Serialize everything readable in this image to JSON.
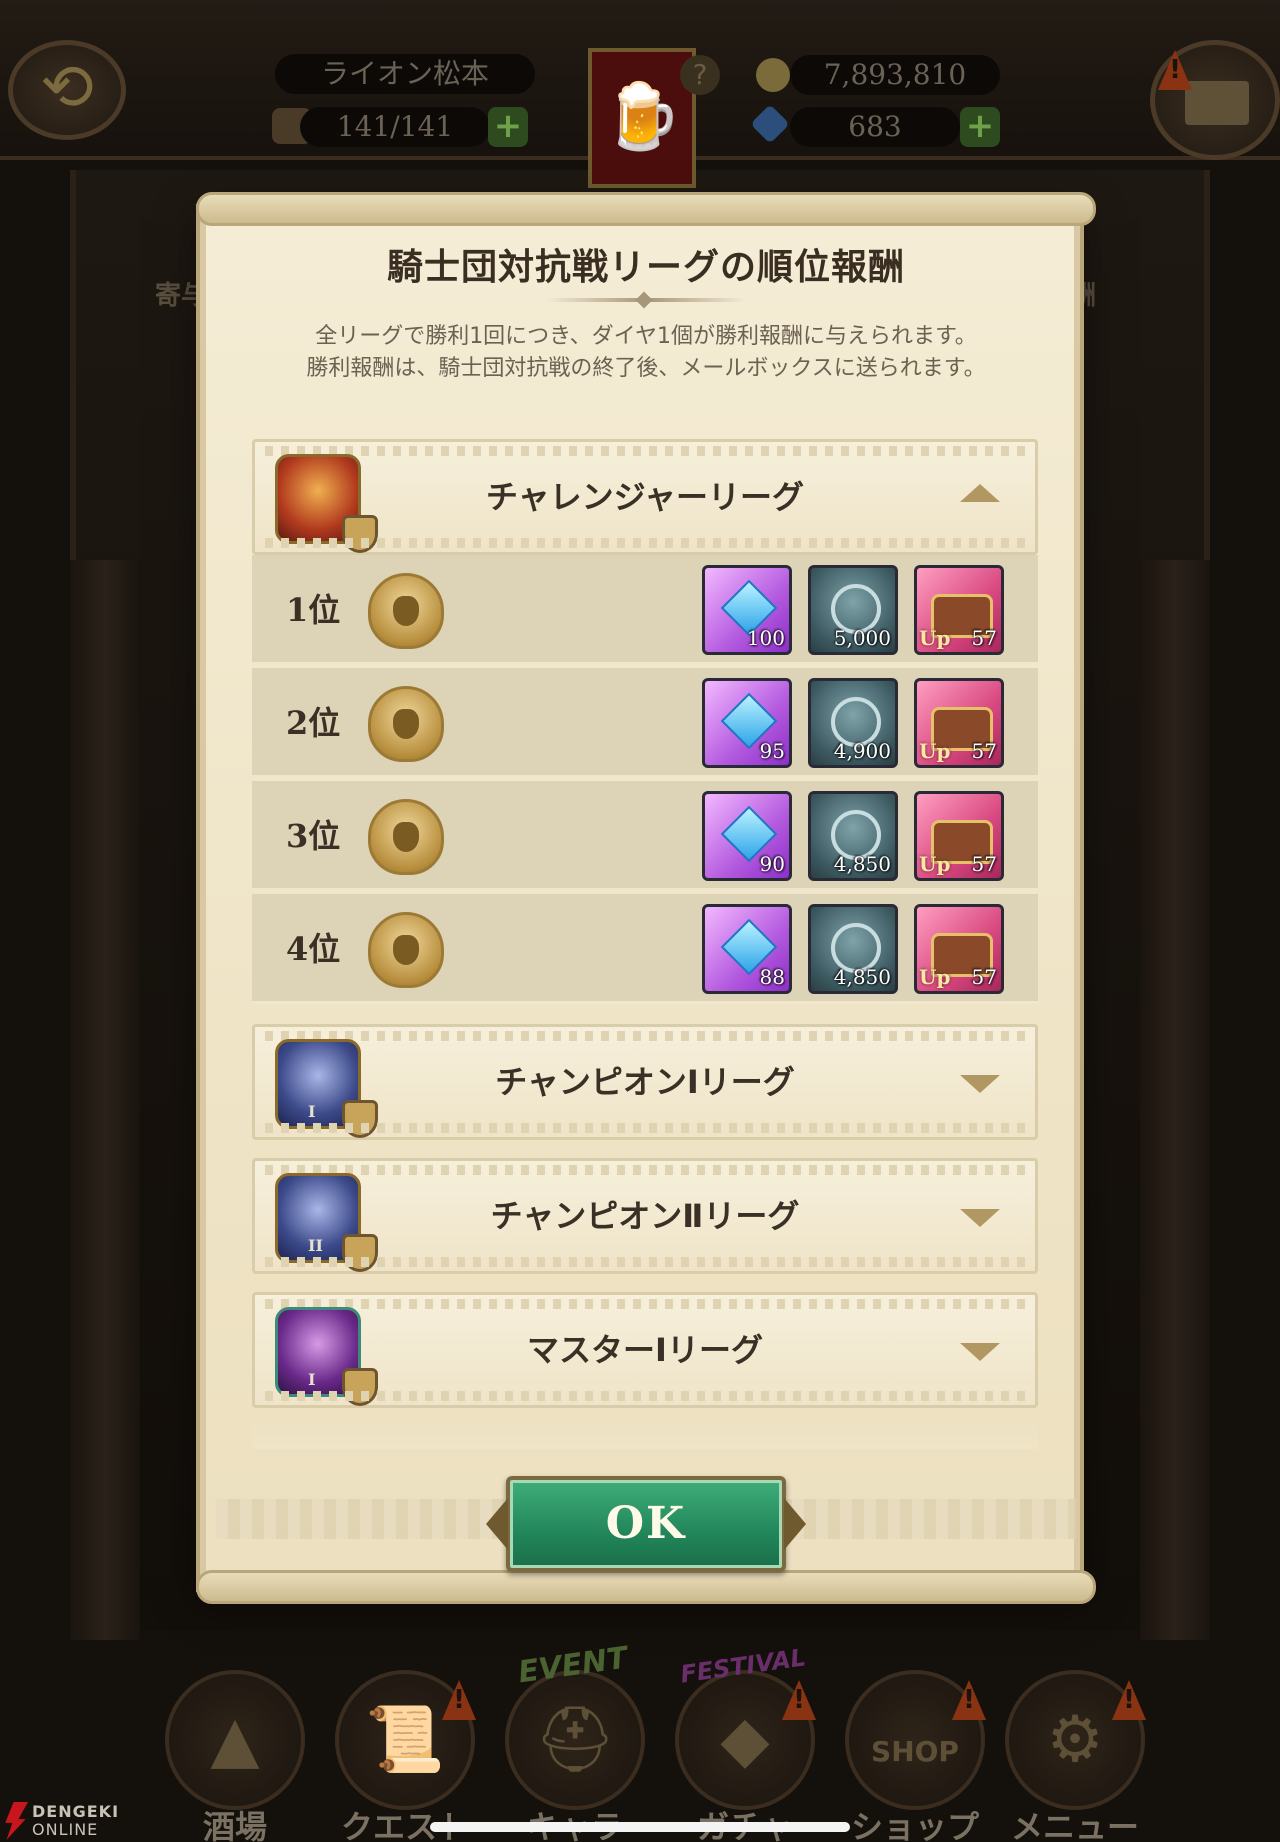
{
  "header": {
    "player_name": "ライオン松本",
    "stamina": "141/141",
    "gold": "7,893,810",
    "gems": "683"
  },
  "background_labels": {
    "left_partial": "寄与",
    "right_partial": "酬"
  },
  "dialog": {
    "title": "騎士団対抗戦リーグの順位報酬",
    "description_line1": "全リーグで勝利1回につき、ダイヤ1個が勝利報酬に与えられます。",
    "description_line2": "勝利報酬は、騎士団対抗戦の終了後、メールボックスに送られます。",
    "ok_label": "OK"
  },
  "leagues": [
    {
      "name": "チャレンジャーリーグ",
      "expanded": true,
      "emblem_roman": "",
      "ranks": [
        {
          "label": "1位",
          "gems": "100",
          "medals": "5,000",
          "chest_tag": "Up",
          "chests": "57"
        },
        {
          "label": "2位",
          "gems": "95",
          "medals": "4,900",
          "chest_tag": "Up",
          "chests": "57"
        },
        {
          "label": "3位",
          "gems": "90",
          "medals": "4,850",
          "chest_tag": "Up",
          "chests": "57"
        },
        {
          "label": "4位",
          "gems": "88",
          "medals": "4,850",
          "chest_tag": "Up",
          "chests": "57"
        }
      ]
    },
    {
      "name": "チャンピオンⅠリーグ",
      "expanded": false,
      "emblem_roman": "I"
    },
    {
      "name": "チャンピオンⅡリーグ",
      "expanded": false,
      "emblem_roman": "II"
    },
    {
      "name": "マスターⅠリーグ",
      "expanded": false,
      "emblem_roman": "I"
    }
  ],
  "bottom_nav": {
    "tavern": "酒場",
    "quest": "クエスト",
    "chara": "キャラ",
    "gacha": "ガチャ",
    "shop": "ショップ",
    "menu": "メニュー",
    "event_tag": "EVENT",
    "festival_tag": "FESTIVAL",
    "shop_sign": "SHOP"
  },
  "watermark": {
    "line1": "DENGEKI",
    "line2": "ONLINE"
  },
  "colors": {
    "parchment": "#efe4c6",
    "ok_green": "#22865a",
    "rank_row": "#ddd3b6",
    "gem_purple": "#b35adf",
    "chest_pink": "#d84880"
  },
  "icons": {
    "back": "back-arrow-icon",
    "mail": "mail-icon",
    "stamina": "boot-icon",
    "gold": "coin-icon",
    "gem": "diamond-icon",
    "expand": "chevron-down-icon",
    "collapse": "chevron-up-icon"
  }
}
